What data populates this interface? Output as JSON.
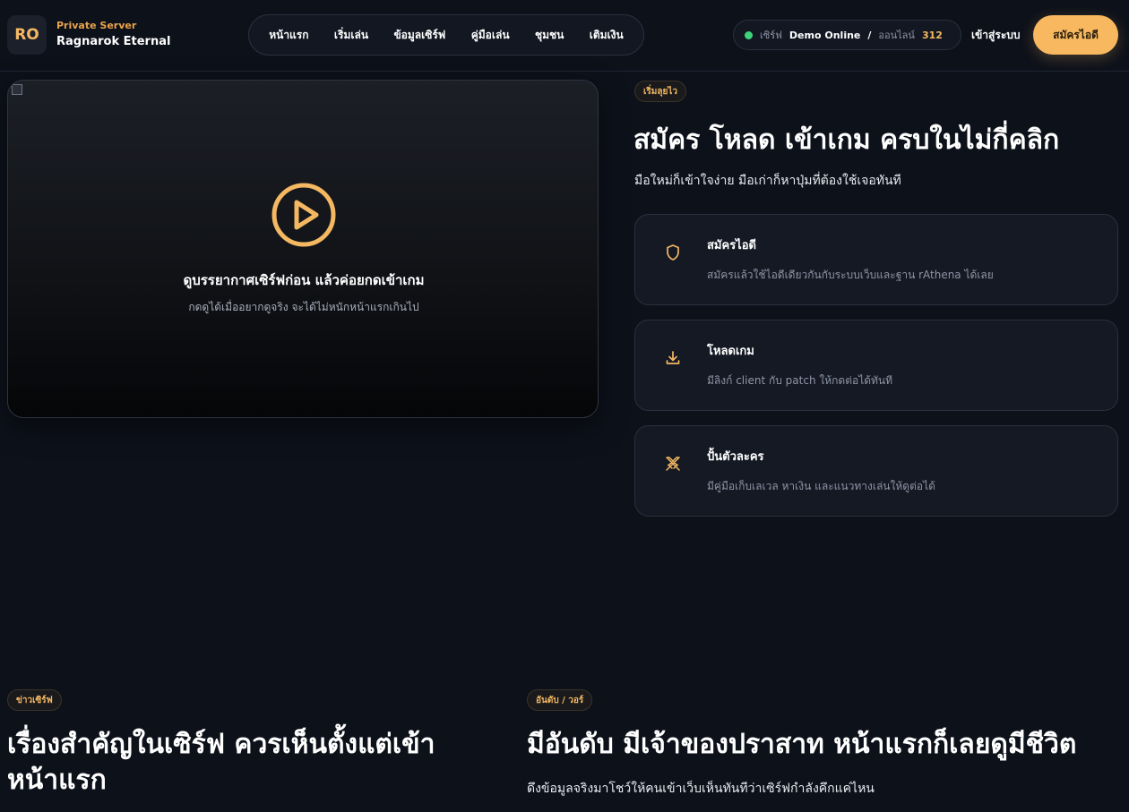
{
  "brand": {
    "logo_text": "RO",
    "subtitle": "Private Server",
    "name": "Ragnarok Eternal"
  },
  "nav": {
    "items": [
      "หน้าแรก",
      "เริ่มเล่น",
      "ข้อมูลเซิร์ฟ",
      "คู่มือเล่น",
      "ชุมชน",
      "เติมเงิน"
    ]
  },
  "status": {
    "server_label": "เซิร์ฟ",
    "server_value": "Demo Online",
    "separator": "/",
    "online_label": "ออนไลน์",
    "online_count": "312",
    "indicator_color": "#3ed37a"
  },
  "auth": {
    "login": "เข้าสู่ระบบ",
    "register": "สมัครไอดี"
  },
  "video": {
    "title": "ดูบรรยากาศเซิร์ฟก่อน แล้วค่อยกดเข้าเกม",
    "subtitle": "กดดูได้เมื่ออยากดูจริง จะได้ไม่หนักหน้าแรกเกินไป",
    "play_icon": "play-circle-icon"
  },
  "quick_start": {
    "badge": "เริ่มลุยไว",
    "title": "สมัคร โหลด เข้าเกม ครบในไม่กี่คลิก",
    "subtitle": "มือใหม่ก็เข้าใจง่าย มือเก่าก็หาปุ่มที่ต้องใช้เจอทันที",
    "steps": [
      {
        "icon": "shield-icon",
        "title": "สมัครไอดี",
        "desc": "สมัครแล้วใช้ไอดีเดียวกันกับระบบเว็บและฐาน rAthena ได้เลย"
      },
      {
        "icon": "download-icon",
        "title": "โหลดเกม",
        "desc": "มีลิงก์ client กับ patch ให้กดต่อได้ทันที"
      },
      {
        "icon": "swords-icon",
        "title": "ปั้นตัวละคร",
        "desc": "มีคู่มือเก็บเลเวล หาเงิน และแนวทางเล่นให้ดูต่อได้"
      }
    ]
  },
  "news": {
    "badge": "ข่าวเซิร์ฟ",
    "title": "เรื่องสำคัญในเซิร์ฟ ควรเห็นตั้งแต่เข้าหน้าแรก"
  },
  "ranking": {
    "badge": "อันดับ / วอร์",
    "title": "มีอันดับ มีเจ้าของปราสาท หน้าแรกก็เลยดูมีชีวิต",
    "subtitle": "ดึงข้อมูลจริงมาโชว์ให้คนเข้าเว็บเห็นทันทีว่าเซิร์ฟกำลังคึกแค่ไหน"
  },
  "colors": {
    "accent": "#f7b85f",
    "background": "#0d111a",
    "card": "#141923"
  }
}
